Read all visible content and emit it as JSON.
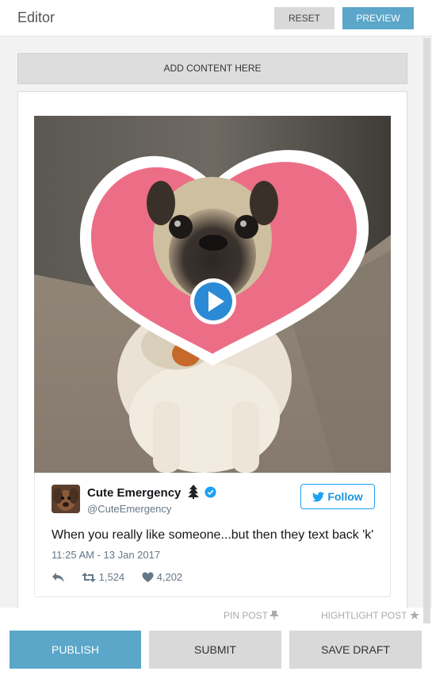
{
  "header": {
    "title": "Editor",
    "reset_label": "RESET",
    "preview_label": "PREVIEW"
  },
  "editor": {
    "add_content_label": "ADD CONTENT HERE"
  },
  "tweet": {
    "name": "Cute Emergency",
    "name_emoji": "tree-icon",
    "verified": true,
    "handle": "@CuteEmergency",
    "follow_label": "Follow",
    "text": "When you really like someone...but then they text back 'k'",
    "timestamp": "11:25 AM - 13 Jan 2017",
    "retweets": "1,524",
    "likes": "4,202",
    "media": "pug-with-heart-video",
    "play_icon": "play-icon"
  },
  "post_options": {
    "pin_label": "PIN POST",
    "highlight_label": "HIGHTLIGHT POST"
  },
  "footer": {
    "publish_label": "PUBLISH",
    "submit_label": "SUBMIT",
    "save_draft_label": "SAVE DRAFT"
  },
  "colors": {
    "accent": "#5ba6c9",
    "twitter_blue": "#1da1f2",
    "button_gray": "#d9d9d9",
    "workspace": "#f2f2f2"
  }
}
